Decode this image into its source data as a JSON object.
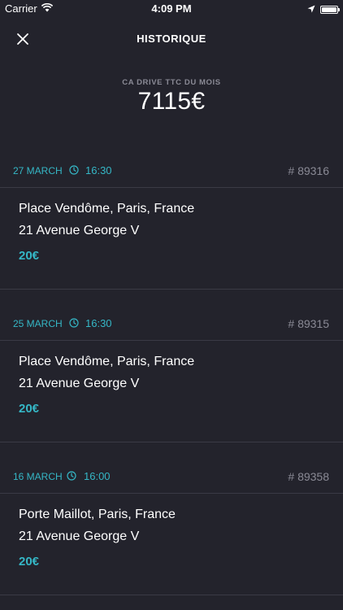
{
  "status_bar": {
    "carrier": "Carrier",
    "time": "4:09 PM"
  },
  "nav": {
    "title": "HISTORIQUE",
    "close_icon": "close-icon"
  },
  "summary": {
    "label": "CA DRIVE TTC DU MOIS",
    "value": "7115€"
  },
  "accent_color": "#35b7c6",
  "rides": [
    {
      "date": "27 MARCH",
      "time": "16:30",
      "id": "# 89316",
      "from": "Place Vendôme, Paris, France",
      "to": "21 Avenue George V",
      "price": "20€"
    },
    {
      "date": "25 MARCH",
      "time": "16:30",
      "id": "# 89315",
      "from": "Place Vendôme, Paris, France",
      "to": "21 Avenue George V",
      "price": "20€"
    },
    {
      "date": "16 MARCH",
      "time": "16:00",
      "id": "# 89358",
      "from": "Porte Maillot, Paris, France",
      "to": "21 Avenue George V",
      "price": "20€"
    }
  ]
}
